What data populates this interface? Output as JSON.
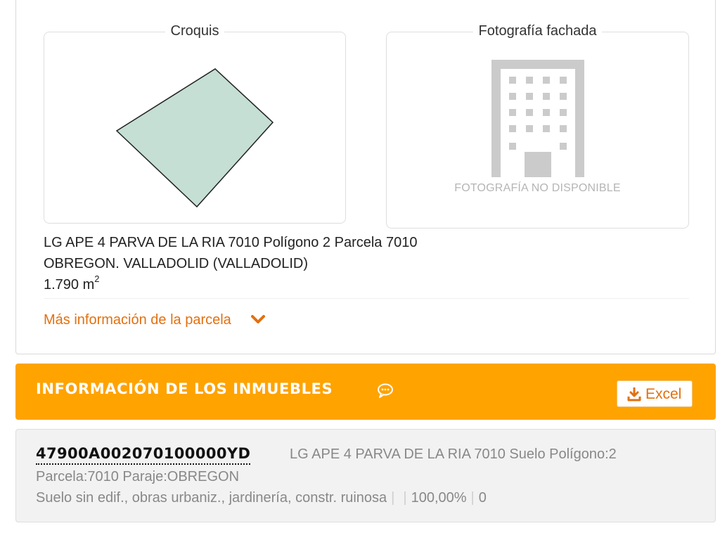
{
  "parcel": {
    "croquis_label": "Croquis",
    "photo_label": "Fotografía fachada",
    "photo_caption": "FOTOGRAFÍA NO DISPONIBLE",
    "address_line1": "LG APE 4 PARVA DE LA RIA 7010 Polígono 2 Parcela 7010",
    "address_line2": "OBREGON. VALLADOLID (VALLADOLID)",
    "area_value": "1.790 m",
    "area_sup": "2",
    "more_link": "Más información de la parcela",
    "icons": [
      "parcel-sketch-icon",
      "building-placeholder-icon",
      "chevron-down-icon"
    ],
    "sketch_fill": "#c5dfd4"
  },
  "buildings_section": {
    "title": "INFORMACIÓN DE LOS INMUEBLES",
    "excel_label": "Excel",
    "accent_color": "#ffa300",
    "link_color": "#e2700f",
    "icons": [
      "chat-icon",
      "download-icon"
    ]
  },
  "property": {
    "reference": "47900A002070100000YD",
    "location_line1": "LG APE 4 PARVA DE LA RIA 7010 Suelo Polígono:2",
    "location_line2": "Parcela:7010 Paraje:OBREGON",
    "use": "Suelo sin edif., obras urbaniz., jardinería, constr. ruinosa",
    "sep": "|",
    "percentage": "100,00%",
    "count": "0"
  }
}
